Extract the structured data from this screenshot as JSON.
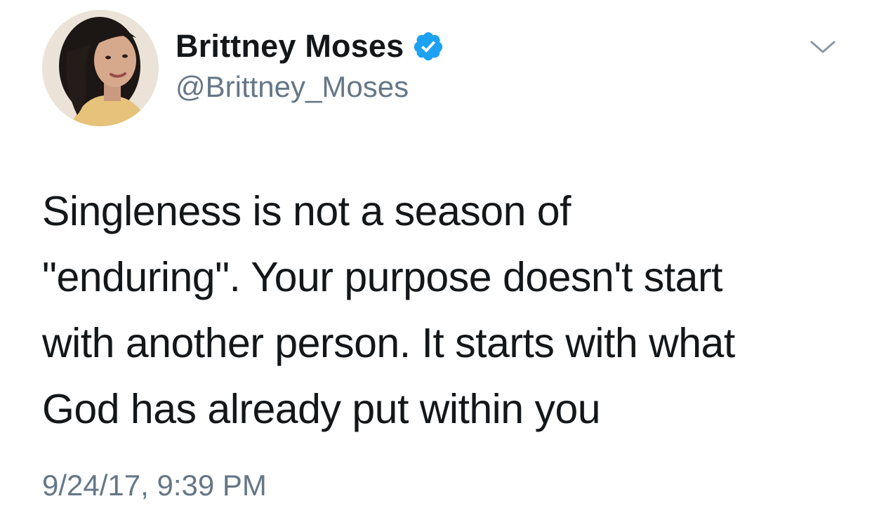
{
  "author": {
    "display_name": "Brittney Moses",
    "handle": "@Brittney_Moses",
    "verified": true,
    "avatar_icon": "profile-photo"
  },
  "tweet": {
    "lines": [
      "Singleness is not a season of",
      "\"enduring\". Your purpose doesn't start",
      "with another person. It starts with what",
      "God has already put within you"
    ],
    "timestamp": "9/24/17, 9:39 PM"
  },
  "menu": {
    "icon": "chevron-down-icon"
  },
  "colors": {
    "text": "#14171a",
    "secondary": "#657786",
    "verified_blue": "#1da1f2",
    "background": "#ffffff"
  }
}
